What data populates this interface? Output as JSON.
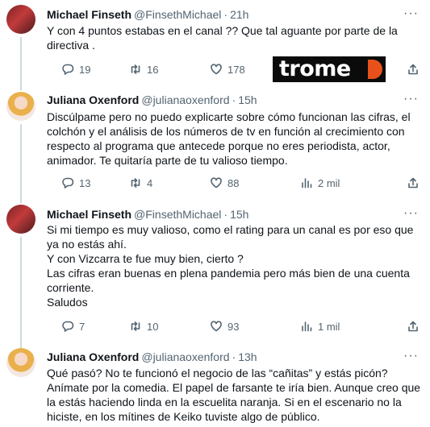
{
  "tweets": [
    {
      "name": "Michael Finseth",
      "handle": "@FinsethMichael",
      "time": "21h",
      "lines": [
        "Y con 4 puntos estabas en el canal ?? Que tal aguante por parte de la",
        "directiva ."
      ],
      "replies": "19",
      "retweets": "16",
      "likes": "178",
      "views": ""
    },
    {
      "name": "Juliana Oxenford",
      "handle": "@julianaoxenford",
      "time": "15h",
      "lines": [
        "Discúlpame pero no puedo explicarte sobre cómo funcionan las cifras, el",
        "colchón y el análisis de los números de tv en función al crecimiento con",
        "respecto al programa que antecede porque no eres periodista, actor,",
        "animador. Te quitaría parte de tu valioso tiempo."
      ],
      "replies": "13",
      "retweets": "4",
      "likes": "88",
      "views": "2 mil"
    },
    {
      "name": "Michael Finseth",
      "handle": "@FinsethMichael",
      "time": "15h",
      "lines": [
        "Si mi tiempo es muy valioso, como el rating para un canal es por eso que",
        "ya no estás ahí.",
        "Y con Vizcarra te fue muy bien, cierto ?",
        "Las cifras eran buenas en plena pandemia pero más bien de una cuenta",
        "corriente.",
        "Saludos"
      ],
      "replies": "7",
      "retweets": "10",
      "likes": "93",
      "views": "1 mil"
    },
    {
      "name": "Juliana Oxenford",
      "handle": "@julianaoxenford",
      "time": "13h",
      "lines": [
        "Qué pasó? No te funcionó el negocio de las “cañitas” y estás picón?",
        "Anímate por la comedia. El papel de farsante te iría bien. Aunque creo que",
        "la estás haciendo linda en la escuelita naranja. Si en el escenario no la",
        "hiciste, en los mítines de Keiko tuviste algo de público."
      ]
    }
  ],
  "watermark": "trome",
  "more_glyph": "···",
  "icons": [
    "reply-icon",
    "retweet-icon",
    "like-icon",
    "views-icon",
    "share-icon",
    "more-icon"
  ],
  "colors": {
    "text": "#0f1419",
    "muted": "#536471",
    "watermark_bg": "#0b0b0b",
    "watermark_accent": "#e8511b"
  }
}
